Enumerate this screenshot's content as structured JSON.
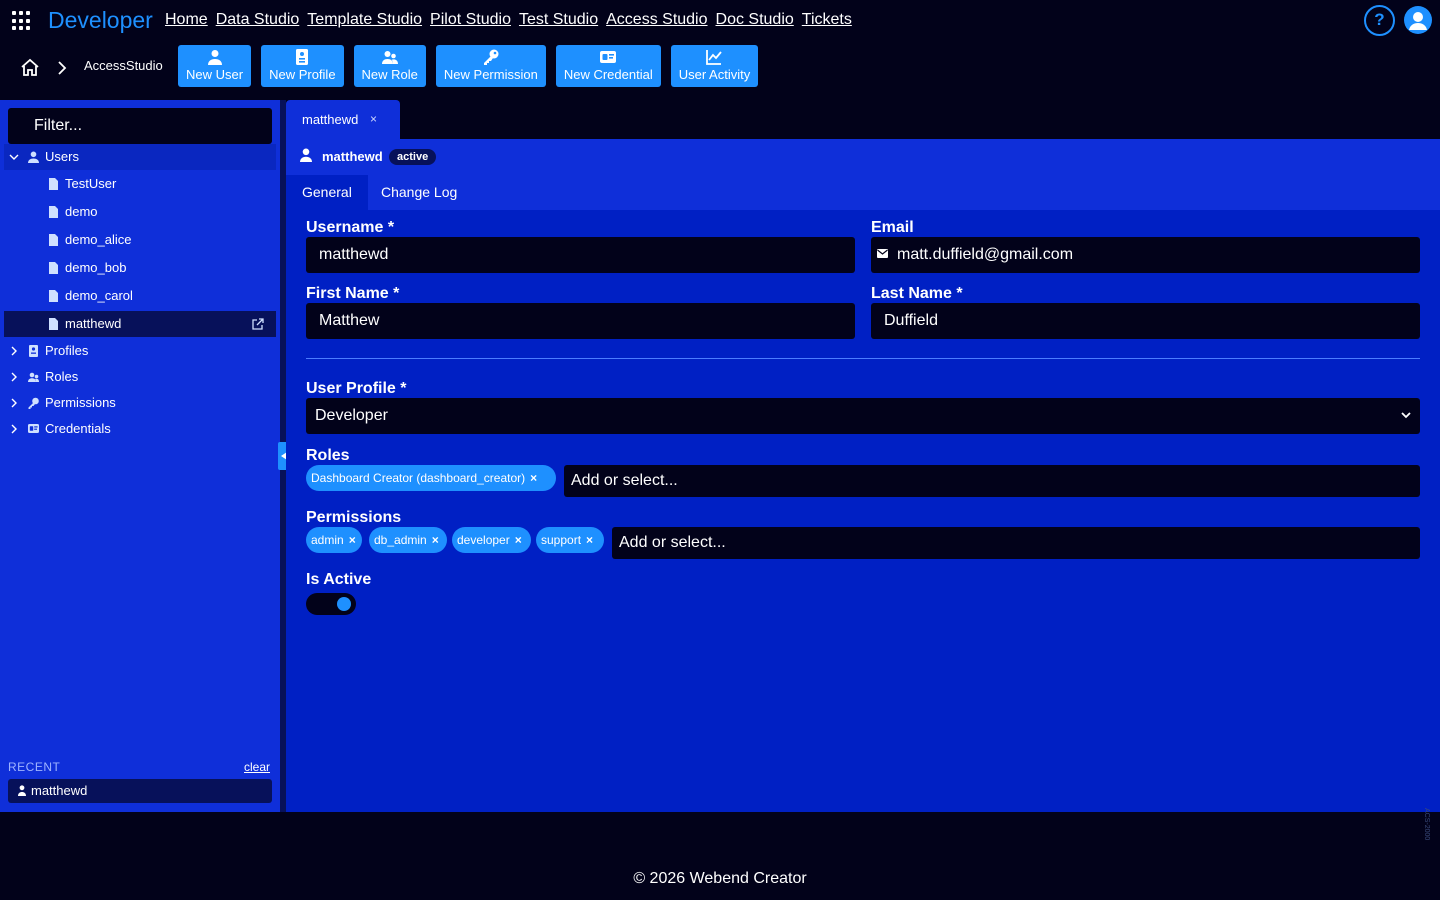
{
  "brand": "Developer",
  "nav": [
    "Home",
    "Data Studio",
    "Template Studio",
    "Pilot Studio",
    "Test Studio",
    "Access Studio",
    "Doc Studio",
    "Tickets"
  ],
  "help": "?",
  "breadcrumb": "AccessStudio",
  "toolbar": [
    {
      "label": "New User",
      "icon": "user-icon"
    },
    {
      "label": "New Profile",
      "icon": "profile-card-icon"
    },
    {
      "label": "New Role",
      "icon": "users-icon"
    },
    {
      "label": "New Permission",
      "icon": "key-icon"
    },
    {
      "label": "New Credential",
      "icon": "credential-icon"
    },
    {
      "label": "User Activity",
      "icon": "chart-line-icon"
    }
  ],
  "sidebar": {
    "filter_placeholder": "Filter...",
    "groups": [
      {
        "label": "Users",
        "expanded": true,
        "icon": "user-icon",
        "items": [
          "TestUser",
          "demo",
          "demo_alice",
          "demo_bob",
          "demo_carol",
          "matthewd"
        ],
        "selected": "matthewd"
      },
      {
        "label": "Profiles",
        "expanded": false,
        "icon": "profile-card-icon"
      },
      {
        "label": "Roles",
        "expanded": false,
        "icon": "users-icon"
      },
      {
        "label": "Permissions",
        "expanded": false,
        "icon": "key-icon"
      },
      {
        "label": "Credentials",
        "expanded": false,
        "icon": "credential-icon"
      }
    ],
    "recent_label": "RECENT",
    "recent_clear": "clear",
    "recent": [
      "matthewd"
    ]
  },
  "doc_tab": {
    "label": "matthewd",
    "close": "×"
  },
  "record": {
    "name": "matthewd",
    "status": "active",
    "subtabs": [
      "General",
      "Change Log"
    ],
    "active_subtab": "General"
  },
  "form": {
    "username_label": "Username *",
    "username": "matthewd",
    "email_label": "Email",
    "email": "matt.duffield@gmail.com",
    "first_name_label": "First Name *",
    "first_name": "Matthew",
    "last_name_label": "Last Name *",
    "last_name": "Duffield",
    "profile_label": "User Profile *",
    "profile": "Developer",
    "roles_label": "Roles",
    "roles": [
      "Dashboard Creator (dashboard_creator)"
    ],
    "roles_placeholder": "Add or select...",
    "permissions_label": "Permissions",
    "permissions": [
      "admin",
      "db_admin",
      "developer",
      "support"
    ],
    "permissions_placeholder": "Add or select...",
    "active_label": "Is Active",
    "active": true
  },
  "footer": "© 2026 Webend Creator",
  "version": "ACS-2000",
  "colors": {
    "accent": "#1e90ff",
    "panel": "#0020c4",
    "sidebar": "#0f2fd9",
    "background": "#02021a"
  }
}
